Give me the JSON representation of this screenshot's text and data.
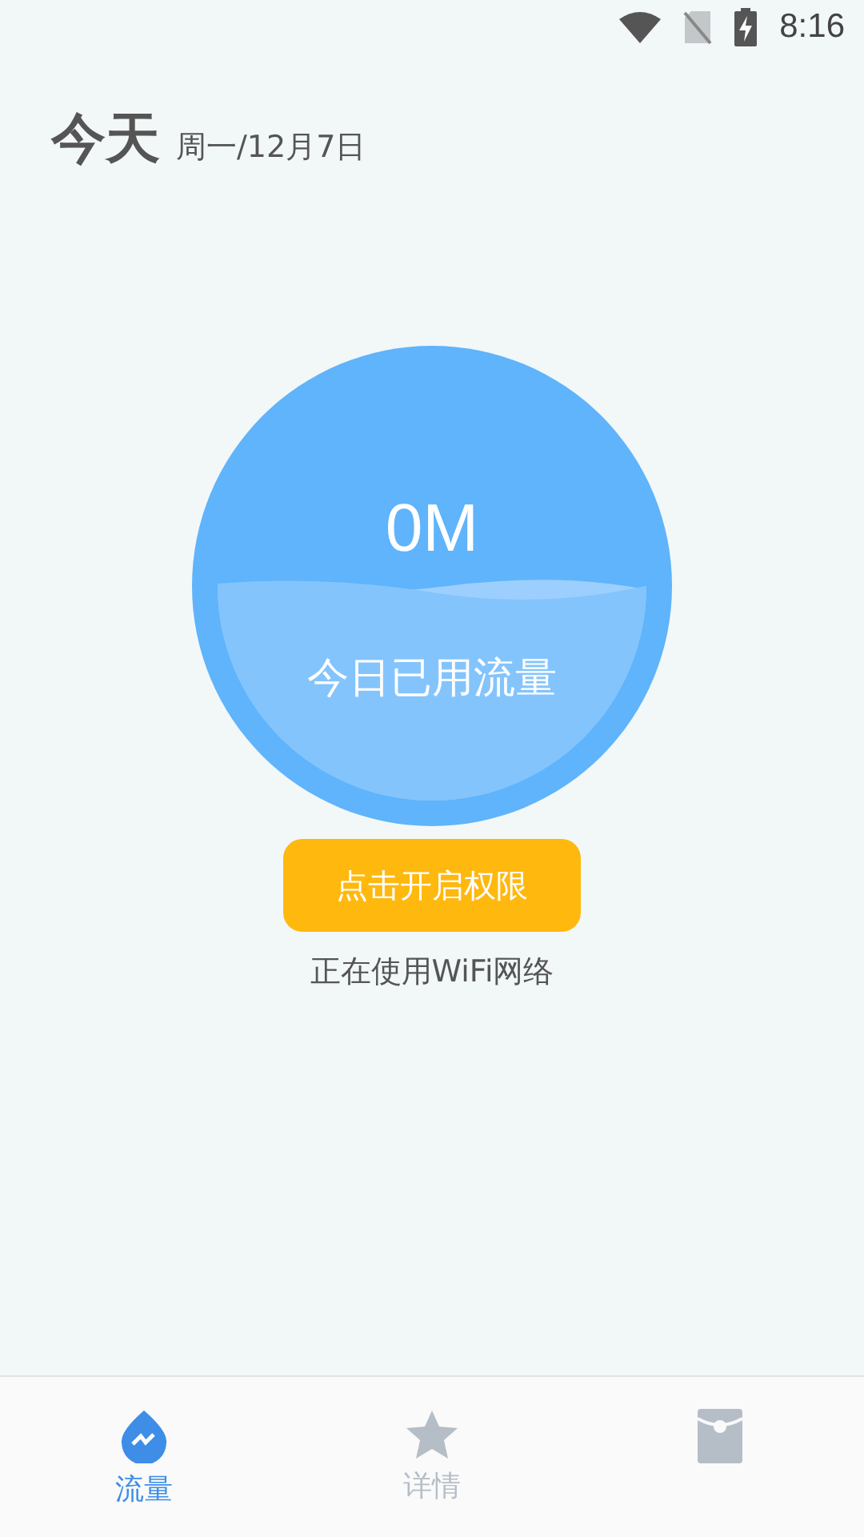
{
  "status_bar": {
    "time": "8:16"
  },
  "header": {
    "title": "今天",
    "date": "周一/12月7日"
  },
  "gauge": {
    "value": "0M",
    "label": "今日已用流量"
  },
  "permission_button": {
    "label": "点击开启权限"
  },
  "network_status": "正在使用WiFi网络",
  "tabs": [
    {
      "kind": "traffic",
      "label": "流量",
      "selected": true
    },
    {
      "kind": "details",
      "label": "详情",
      "selected": false
    },
    {
      "kind": "envelope",
      "selected": false
    }
  ]
}
